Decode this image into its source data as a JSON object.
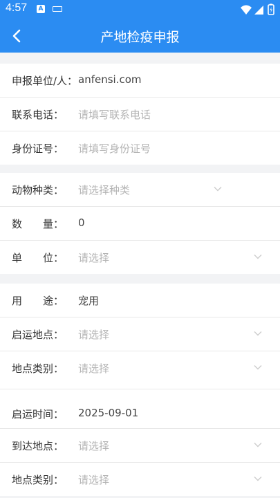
{
  "status_bar": {
    "time": "4:57",
    "notif_letter": "A"
  },
  "nav": {
    "title": "产地检疫申报"
  },
  "sections": [
    {
      "rows": [
        {
          "label": "申报单位/人：",
          "value": "anfensi.com"
        },
        {
          "label": "联系电话：",
          "placeholder": "请填写联系电话"
        },
        {
          "label": "身份证号：",
          "placeholder": "请填写身份证号"
        }
      ]
    },
    {
      "rows": [
        {
          "label": "动物种类：",
          "placeholder": "请选择种类"
        },
        {
          "label": "数　　量：",
          "value": "0"
        },
        {
          "label": "单　　位：",
          "placeholder": "请选择"
        }
      ]
    },
    {
      "rows": [
        {
          "label": "用　　途：",
          "value": "宠用"
        },
        {
          "label": "启运地点：",
          "placeholder": "请选择"
        },
        {
          "label": "地点类别：",
          "placeholder": "请选择"
        },
        {
          "label": "启运时间：",
          "value": "2025-09-01"
        },
        {
          "label": "到达地点：",
          "placeholder": "请选择"
        },
        {
          "label": "地点类别：",
          "placeholder": "请选择"
        }
      ]
    }
  ]
}
